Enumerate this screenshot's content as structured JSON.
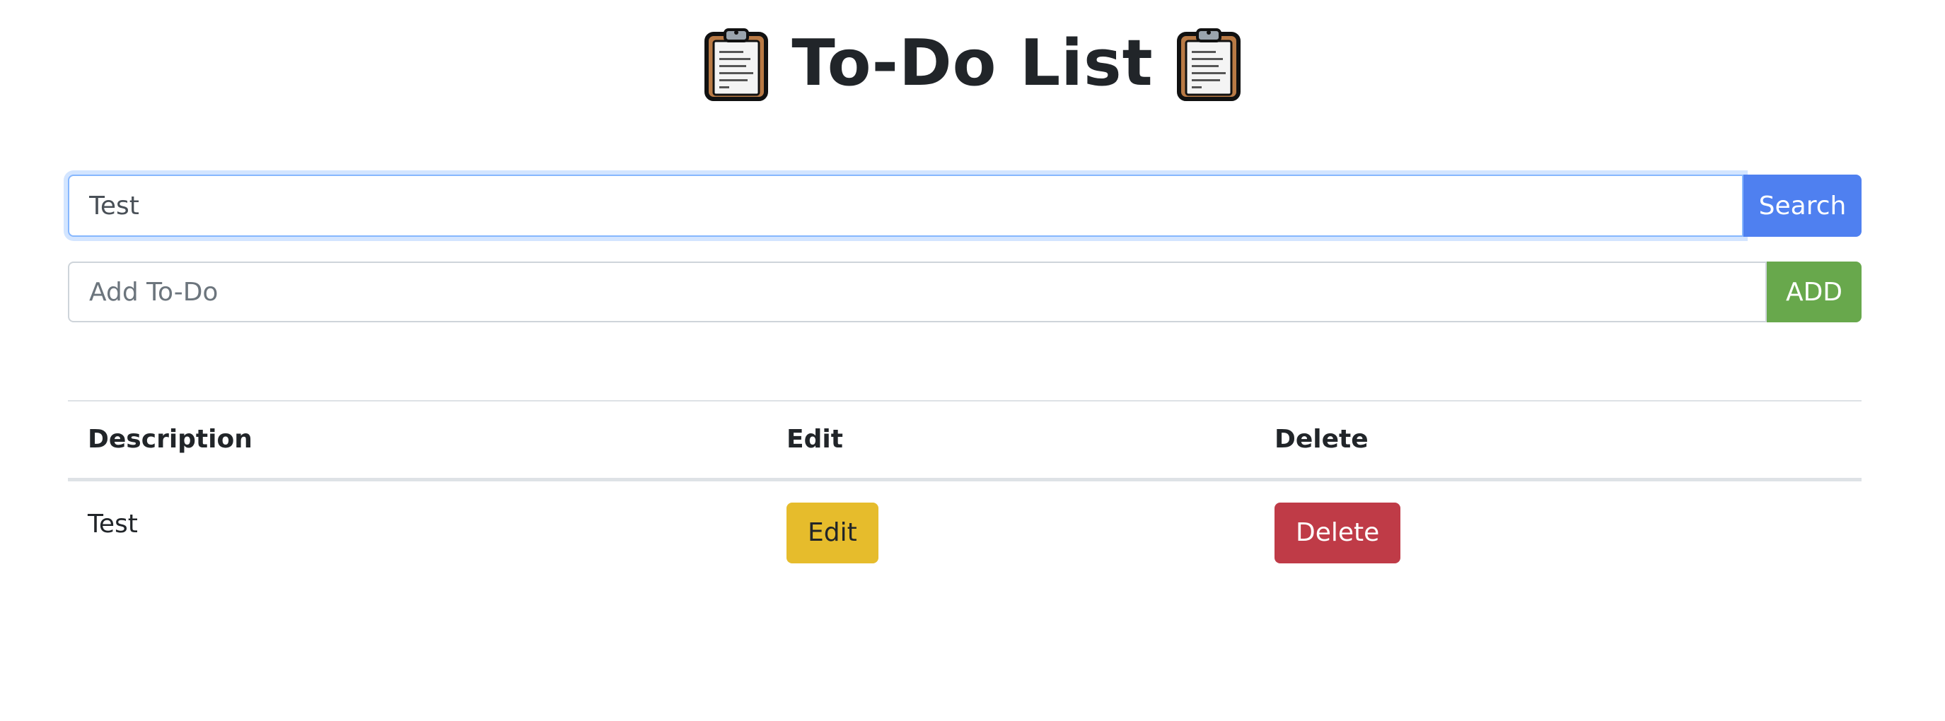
{
  "header": {
    "title": "To-Do List",
    "icon": "clipboard-icon"
  },
  "search": {
    "value": "Test",
    "button_label": "Search",
    "button_color": "#4f80f0"
  },
  "add": {
    "placeholder": "Add To-Do",
    "value": "",
    "button_label": "ADD",
    "button_color": "#68a84c"
  },
  "table": {
    "headers": [
      "Description",
      "Edit",
      "Delete"
    ],
    "rows": [
      {
        "description": "Test",
        "edit_label": "Edit",
        "delete_label": "Delete"
      }
    ]
  },
  "colors": {
    "edit_button": "#e6bc2c",
    "delete_button": "#bf3b47",
    "text": "#212529"
  }
}
